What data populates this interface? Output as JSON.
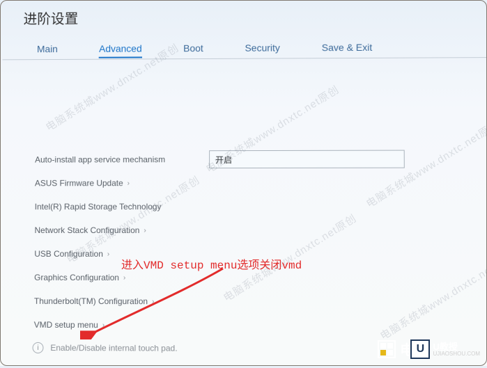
{
  "title": "进阶设置",
  "tabs": {
    "main": "Main",
    "advanced": "Advanced",
    "boot": "Boot",
    "security": "Security",
    "saveexit": "Save & Exit"
  },
  "items": {
    "auto": "Auto-install app service mechanism",
    "auto_value": "开启",
    "asus": "ASUS Firmware Update",
    "irst": "Intel(R) Rapid Storage Technology",
    "netstack": "Network Stack Configuration",
    "usb": "USB Configuration",
    "graphics": "Graphics Configuration",
    "thunderbolt": "Thunderbolt(TM) Configuration",
    "vmd": "VMD setup menu",
    "hint": "Enable/Disable internal touch pad."
  },
  "annotation": "进入VMD setup menu选项关闭vmd",
  "watermark_text": "电脑系统城www.dnxtc.net原创",
  "logos": {
    "dian": "电",
    "uj_letter": "U",
    "uj_cn": "U教授",
    "uj_en": "UJIAOSHOU.COM"
  }
}
